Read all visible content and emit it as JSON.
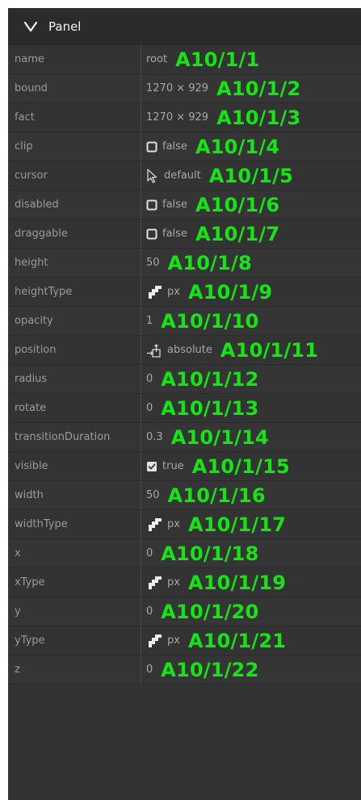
{
  "panel": {
    "title": "Panel",
    "expand_icon": "chevron-down-icon"
  },
  "colors": {
    "panel_bg": "#333333",
    "key_text": "#9a9a9a",
    "value_text": "#a8a8a8",
    "label_green": "#14e614"
  },
  "rows": [
    {
      "key": "name",
      "value": "root",
      "icon": "",
      "label": "A10/1/1"
    },
    {
      "key": "bound",
      "value": "1270 × 929",
      "icon": "",
      "label": "A10/1/2"
    },
    {
      "key": "fact",
      "value": "1270 × 929",
      "icon": "",
      "label": "A10/1/3"
    },
    {
      "key": "clip",
      "value": "false",
      "icon": "checkbox-unchecked-icon",
      "label": "A10/1/4"
    },
    {
      "key": "cursor",
      "value": "default",
      "icon": "cursor-arrow-icon",
      "label": "A10/1/5"
    },
    {
      "key": "disabled",
      "value": "false",
      "icon": "checkbox-unchecked-icon",
      "label": "A10/1/6"
    },
    {
      "key": "draggable",
      "value": "false",
      "icon": "checkbox-unchecked-icon",
      "label": "A10/1/7"
    },
    {
      "key": "height",
      "value": "50",
      "icon": "",
      "label": "A10/1/8"
    },
    {
      "key": "heightType",
      "value": "px",
      "icon": "pixel-grid-icon",
      "label": "A10/1/9"
    },
    {
      "key": "opacity",
      "value": "1",
      "icon": "",
      "label": "A10/1/10"
    },
    {
      "key": "position",
      "value": "absolute",
      "icon": "position-absolute-icon",
      "label": "A10/1/11"
    },
    {
      "key": "radius",
      "value": "0",
      "icon": "",
      "label": "A10/1/12"
    },
    {
      "key": "rotate",
      "value": "0",
      "icon": "",
      "label": "A10/1/13"
    },
    {
      "key": "transitionDuration",
      "value": "0.3",
      "icon": "",
      "label": "A10/1/14"
    },
    {
      "key": "visible",
      "value": "true",
      "icon": "checkbox-checked-icon",
      "label": "A10/1/15"
    },
    {
      "key": "width",
      "value": "50",
      "icon": "",
      "label": "A10/1/16"
    },
    {
      "key": "widthType",
      "value": "px",
      "icon": "pixel-grid-icon",
      "label": "A10/1/17"
    },
    {
      "key": "x",
      "value": "0",
      "icon": "",
      "label": "A10/1/18"
    },
    {
      "key": "xType",
      "value": "px",
      "icon": "pixel-grid-icon",
      "label": "A10/1/19"
    },
    {
      "key": "y",
      "value": "0",
      "icon": "",
      "label": "A10/1/20"
    },
    {
      "key": "yType",
      "value": "px",
      "icon": "pixel-grid-icon",
      "label": "A10/1/21"
    },
    {
      "key": "z",
      "value": "0",
      "icon": "",
      "label": "A10/1/22"
    }
  ]
}
